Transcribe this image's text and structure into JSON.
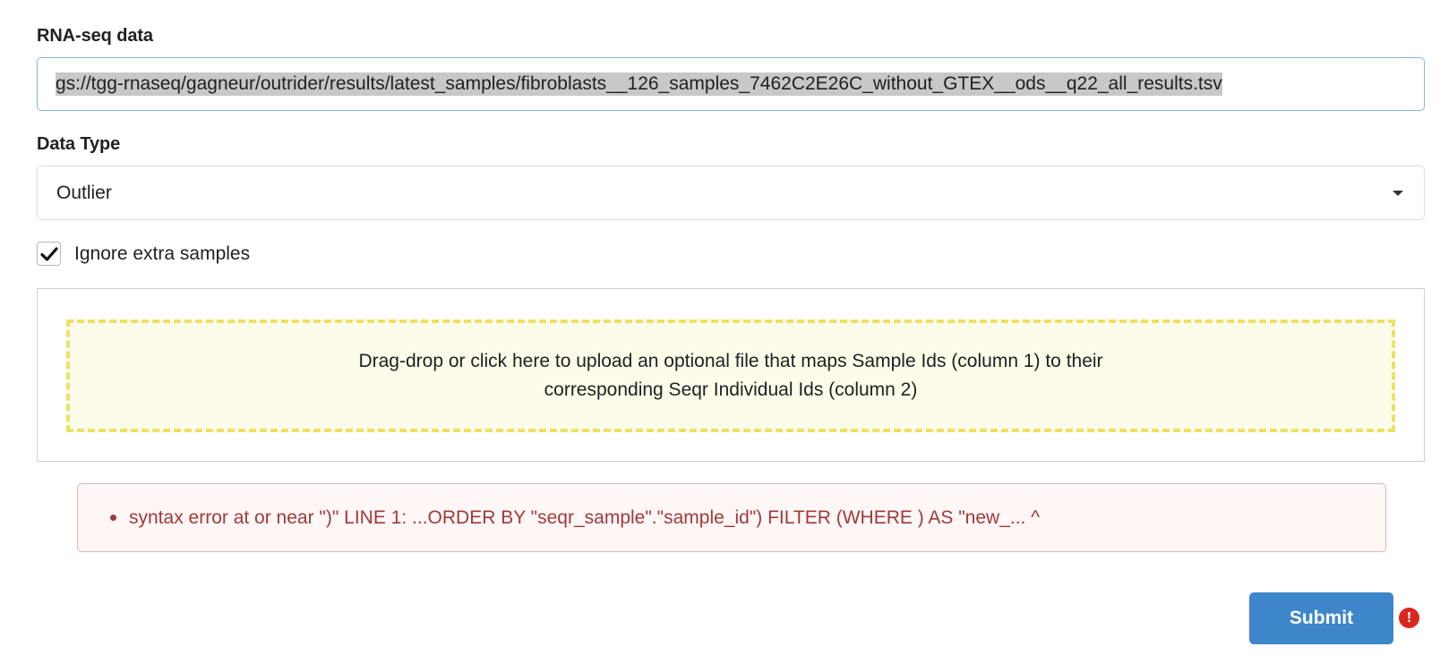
{
  "rna_seq": {
    "label": "RNA-seq data",
    "value": "gs://tgg-rnaseq/gagneur/outrider/results/latest_samples/fibroblasts__126_samples_7462C2E26C_without_GTEX__ods__q22_all_results.tsv"
  },
  "data_type": {
    "label": "Data Type",
    "selected": "Outlier"
  },
  "ignore_extra": {
    "label": "Ignore extra samples",
    "checked": true
  },
  "upload": {
    "text": "Drag-drop or click here to upload an optional file that maps Sample Ids (column 1) to their corresponding Seqr Individual Ids (column 2)"
  },
  "error": {
    "message": "syntax error at or near \")\" LINE 1: ...ORDER BY \"seqr_sample\".\"sample_id\") FILTER (WHERE ) AS \"new_... ^"
  },
  "submit": {
    "label": "Submit",
    "warning_icon": "exclamation-icon"
  },
  "colors": {
    "primary": "#3e86ca",
    "error_text": "#9f3a38",
    "error_bg": "#fff6f6",
    "dropzone_border": "#ece263",
    "dropzone_bg": "#fdfcea",
    "warning": "#d9261e"
  }
}
